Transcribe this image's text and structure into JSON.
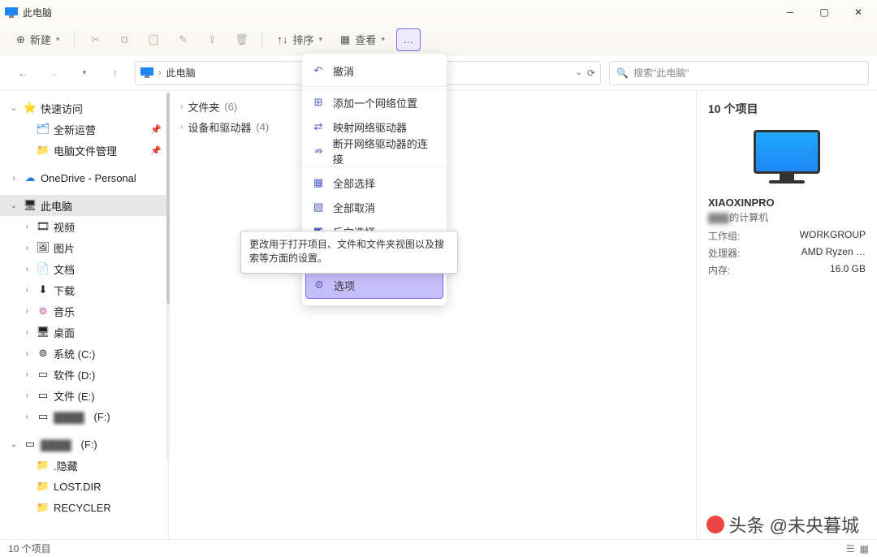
{
  "window_title": "此电脑",
  "toolbar": {
    "new": "新建",
    "sort": "排序",
    "view": "查看"
  },
  "breadcrumb": {
    "root": "此电脑"
  },
  "search": {
    "placeholder": "搜索\"此电脑\""
  },
  "sidebar": {
    "quick_access": "快速访问",
    "qa_items": [
      {
        "label": "全新运营"
      },
      {
        "label": "电脑文件管理"
      }
    ],
    "onedrive": "OneDrive - Personal",
    "this_pc": "此电脑",
    "pc_items": [
      "视频",
      "图片",
      "文档",
      "下载",
      "音乐",
      "桌面",
      "系统 (C:)",
      "软件 (D:)",
      "文件 (E:)",
      "(F:)"
    ],
    "ext_drive": "(F:)",
    "ext_items": [
      ".隐藏",
      "LOST.DIR",
      "RECYCLER"
    ]
  },
  "content": {
    "folders_label": "文件夹",
    "folders_count": "(6)",
    "devices_label": "设备和驱动器",
    "devices_count": "(4)"
  },
  "context_menu": {
    "undo": "撤消",
    "add_net_loc": "添加一个网络位置",
    "map_net_drv": "映射网络驱动器",
    "disconnect_drv": "断开网络驱动器的连接",
    "select_all": "全部选择",
    "deselect_all": "全部取消",
    "invert_sel": "反向选择",
    "options": "选项"
  },
  "tooltip": "更改用于打开项目、文件和文件夹视图以及搜索等方面的设置。",
  "details": {
    "heading": "10 个项目",
    "pc_name": "XIAOXINPRO",
    "pc_sub": "的计算机",
    "workgroup_k": "工作组:",
    "workgroup_v": "WORKGROUP",
    "cpu_k": "处理器:",
    "cpu_v": "AMD Ryzen …",
    "mem_k": "内存:",
    "mem_v": "16.0 GB"
  },
  "status": {
    "text": "10 个项目"
  },
  "watermark": "头条 @未央暮城"
}
